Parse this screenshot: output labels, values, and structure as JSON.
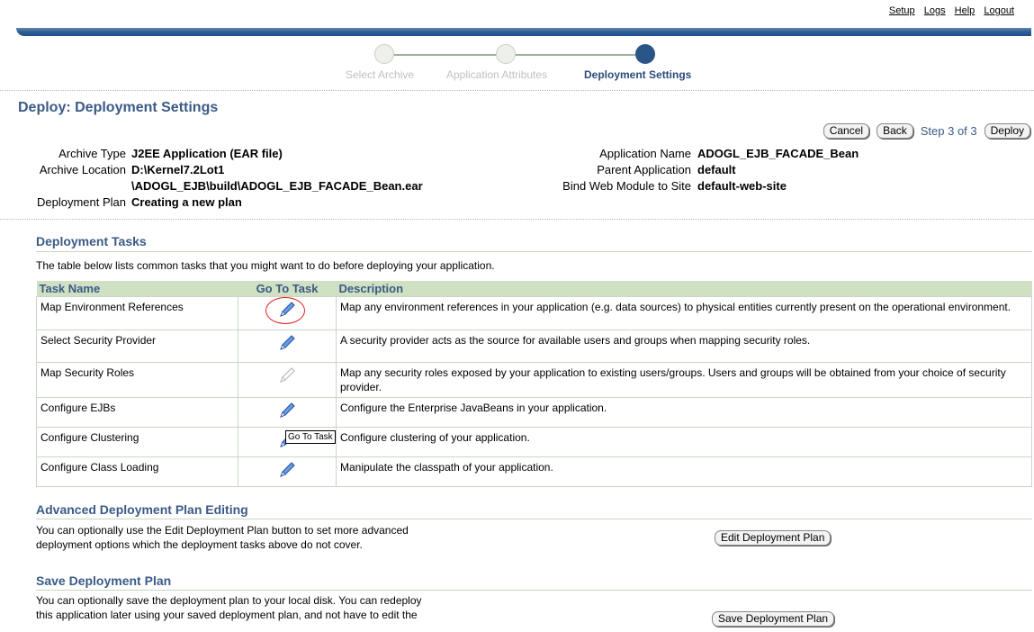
{
  "toplinks": {
    "setup": "Setup",
    "logs": "Logs",
    "help": "Help",
    "logout": "Logout"
  },
  "train": {
    "steps": [
      "Select Archive",
      "Application Attributes",
      "Deployment Settings"
    ],
    "active_step": 3
  },
  "page_title": "Deploy: Deployment Settings",
  "buttons": {
    "cancel": "Cancel",
    "back": "Back",
    "step": "Step 3 of 3",
    "deploy": "Deploy"
  },
  "summary": {
    "archive_type_label": "Archive Type",
    "archive_type": "J2EE Application (EAR file)",
    "archive_location_label": "Archive Location",
    "archive_location_1": "D:\\Kernel7.2Lot1",
    "archive_location_2": "\\ADOGL_EJB\\build\\ADOGL_EJB_FACADE_Bean.ear",
    "deployment_plan_label": "Deployment Plan",
    "deployment_plan": "Creating a new plan",
    "application_name_label": "Application Name",
    "application_name": "ADOGL_EJB_FACADE_Bean",
    "parent_application_label": "Parent Application",
    "parent_application": "default",
    "bind_module_label": "Bind Web Module to Site",
    "bind_module": "default-web-site"
  },
  "tasks_section": {
    "title": "Deployment Tasks",
    "intro": "The table below lists common tasks that you might want to do before deploying your application.",
    "headers": [
      "Task Name",
      "Go To Task",
      "Description"
    ],
    "rows": [
      {
        "name": "Map Environment References",
        "desc": "Map any environment references in your application (e.g. data sources) to physical entities currently present on the operational environment.",
        "enabled": true
      },
      {
        "name": "Select Security Provider",
        "desc": "A security provider acts as the source for available users and groups when mapping security roles.",
        "enabled": true
      },
      {
        "name": "Map Security Roles",
        "desc": "Map any security roles exposed by your application to existing users/groups. Users and groups will be obtained from your choice of security provider.",
        "enabled": false
      },
      {
        "name": "Configure EJBs",
        "desc": "Configure the Enterprise JavaBeans in your application.",
        "enabled": true
      },
      {
        "name": "Configure Clustering",
        "desc": "Configure clustering of your application.",
        "enabled": true
      },
      {
        "name": "Configure Class Loading",
        "desc": "Manipulate the classpath of your application.",
        "enabled": true
      }
    ],
    "tooltip": "Go To Task"
  },
  "advanced_section": {
    "title": "Advanced Deployment Plan Editing",
    "text_1": "You can optionally use the Edit Deployment Plan button to set more advanced",
    "text_2": "deployment options which the deployment tasks above do not cover.",
    "button": "Edit Deployment Plan"
  },
  "save_section": {
    "title": "Save Deployment Plan",
    "text_1": "You can optionally save the deployment plan to your local disk. You can redeploy",
    "text_2": "this application later using your saved deployment plan, and not have to edit the",
    "button": "Save Deployment Plan"
  },
  "colors": {
    "accent": "#3a5a86",
    "header_bg": "#cfe0c3",
    "bar": "#2f5f98"
  }
}
